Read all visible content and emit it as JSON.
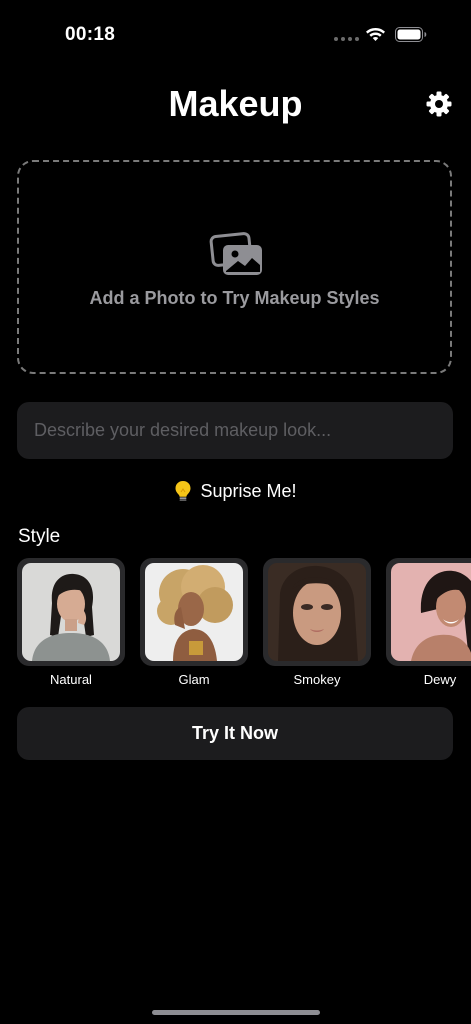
{
  "status_bar": {
    "time": "00:18"
  },
  "header": {
    "title": "Makeup",
    "settings_icon": "gear-icon"
  },
  "upload": {
    "label": "Add a Photo to Try Makeup Styles",
    "icon": "photos-icon"
  },
  "description": {
    "placeholder": "Describe your desired makeup look...",
    "value": ""
  },
  "surprise": {
    "emoji": "lightbulb-icon",
    "label": "Suprise Me!"
  },
  "styles": {
    "heading": "Style",
    "items": [
      {
        "label": "Natural"
      },
      {
        "label": "Glam"
      },
      {
        "label": "Smokey"
      },
      {
        "label": "Dewy"
      }
    ]
  },
  "cta": {
    "label": "Try It Now"
  },
  "colors": {
    "background": "#000000",
    "surface": "#1c1c1e",
    "muted_text": "#9a9a9e",
    "placeholder": "#5e5e62",
    "dashed_border": "#7a7a7a",
    "bulb": "#f5c518"
  }
}
